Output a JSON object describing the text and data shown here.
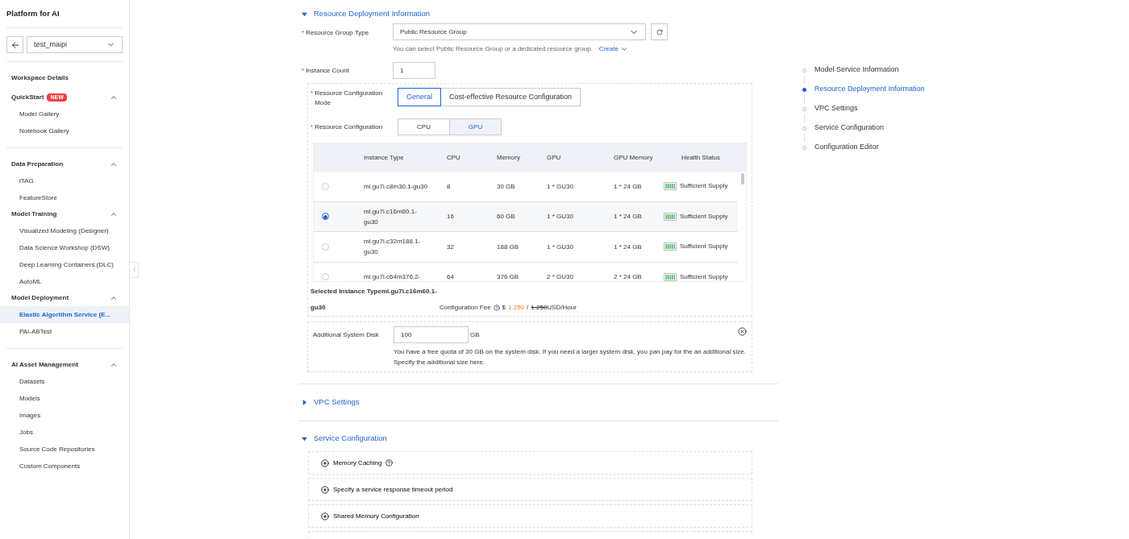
{
  "sidebar": {
    "title": "Platform for AI",
    "workspace": {
      "value": "test_maipi"
    },
    "top_link": "Workspace Details",
    "sections": [
      {
        "groups": [
          {
            "label": "QuickStart",
            "badge": "NEW",
            "expanded": true,
            "items": [
              {
                "label": "Model Gallery",
                "selected": false
              },
              {
                "label": "Notebook Gallery",
                "selected": false
              }
            ]
          }
        ]
      },
      {
        "groups": [
          {
            "label": "Data Preparation",
            "expanded": true,
            "items": [
              {
                "label": "iTAG",
                "selected": false
              },
              {
                "label": "FeatureStore",
                "selected": false
              }
            ]
          },
          {
            "label": "Model Training",
            "expanded": true,
            "items": [
              {
                "label": "Visualized Modeling (Designer)",
                "selected": false
              },
              {
                "label": "Data Science Workshop (DSW)",
                "selected": false
              },
              {
                "label": "Deep Learning Containers (DLC)",
                "selected": false
              },
              {
                "label": "AutoML",
                "selected": false
              }
            ]
          },
          {
            "label": "Model Deployment",
            "expanded": true,
            "items": [
              {
                "label": "Elastic Algorithm Service (E...",
                "selected": true
              },
              {
                "label": "PAI-ABTest",
                "selected": false
              }
            ]
          }
        ]
      },
      {
        "groups": [
          {
            "label": "AI Asset Management",
            "expanded": true,
            "items": [
              {
                "label": "Datasets",
                "selected": false
              },
              {
                "label": "Models",
                "selected": false
              },
              {
                "label": "Images",
                "selected": false
              },
              {
                "label": "Jobs",
                "selected": false
              },
              {
                "label": "Source Code Repositories",
                "selected": false
              },
              {
                "label": "Custom Components",
                "selected": false
              }
            ]
          }
        ]
      }
    ]
  },
  "resource_section": {
    "title": "Resource Deployment Information",
    "expanded": true,
    "resource_group": {
      "required_mark": "*",
      "label": "Resource Group Type",
      "value": "Public Resource Group",
      "hint": "You can select Public Resource Group or a dedicated resource group.",
      "create_link": "Create"
    },
    "instance_count": {
      "required_mark": "*",
      "label": "Instance Count",
      "value": "1"
    },
    "mode": {
      "required_mark": "*",
      "label": "Resource Configuration Mode",
      "options": [
        {
          "label": "General",
          "selected": true
        },
        {
          "label": "Cost-effective Resource Configuration",
          "selected": false
        }
      ]
    },
    "config": {
      "required_mark": "*",
      "label": "Resource Configuration",
      "options": [
        {
          "label": "CPU",
          "selected": false
        },
        {
          "label": "GPU",
          "selected": true
        }
      ]
    },
    "table": {
      "columns": [
        "Instance Type",
        "CPU",
        "Memory",
        "GPU",
        "GPU Memory",
        "Health Status"
      ],
      "rows": [
        {
          "selected": false,
          "cells": [
            "ml.gu7i.c8m30.1-gu30",
            "8",
            "30 GB",
            "1 * GU30",
            "1 * 24 GB",
            "Sufficient Supply"
          ]
        },
        {
          "selected": true,
          "cells": [
            "ml.gu7i.c16m60.1-gu30",
            "16",
            "60 GB",
            "1 * GU30",
            "1 * 24 GB",
            "Sufficient Supply"
          ]
        },
        {
          "selected": false,
          "cells": [
            "ml.gu7i.c32m188.1-gu30",
            "32",
            "188 GB",
            "1 * GU30",
            "1 * 24 GB",
            "Sufficient Supply"
          ]
        },
        {
          "selected": false,
          "cells": [
            "ml.gu7i.c64m376.2-",
            "64",
            "376 GB",
            "2 * GU30",
            "2 * 24 GB",
            "Sufficient Supply"
          ]
        }
      ]
    },
    "selected_instance": {
      "label": "Selected Instance Type",
      "value": "ml.gu7i.c16m60.1-gu30"
    },
    "fee": {
      "label": "Configuration Fee",
      "currency": "$",
      "price": "1.250",
      "separator": "/",
      "original_price": "1.250",
      "unit": "USD/Hour"
    },
    "system_disk": {
      "label": "Additional System Disk",
      "value": "100",
      "unit": "GB",
      "hint": "You have a free quota of 30 GB on the system disk. If you need a larger system disk, you pan pay for the an additional size. Specify the additional size here."
    }
  },
  "vpc_section": {
    "title": "VPC Settings",
    "expanded": false
  },
  "service_section": {
    "title": "Service Configuration",
    "expanded": true,
    "items": [
      {
        "label": "Memory Caching",
        "help": true
      },
      {
        "label": "Specify a service response timeout period",
        "help": false
      },
      {
        "label": "Shared Memory Configuration",
        "help": false
      }
    ]
  },
  "anchor_nav": [
    {
      "label": "Model Service Information",
      "selected": false
    },
    {
      "label": "Resource Deployment Information",
      "selected": true
    },
    {
      "label": "VPC Settings",
      "selected": false
    },
    {
      "label": "Service Configuration",
      "selected": false
    },
    {
      "label": "Configuration Editor",
      "selected": false
    }
  ]
}
